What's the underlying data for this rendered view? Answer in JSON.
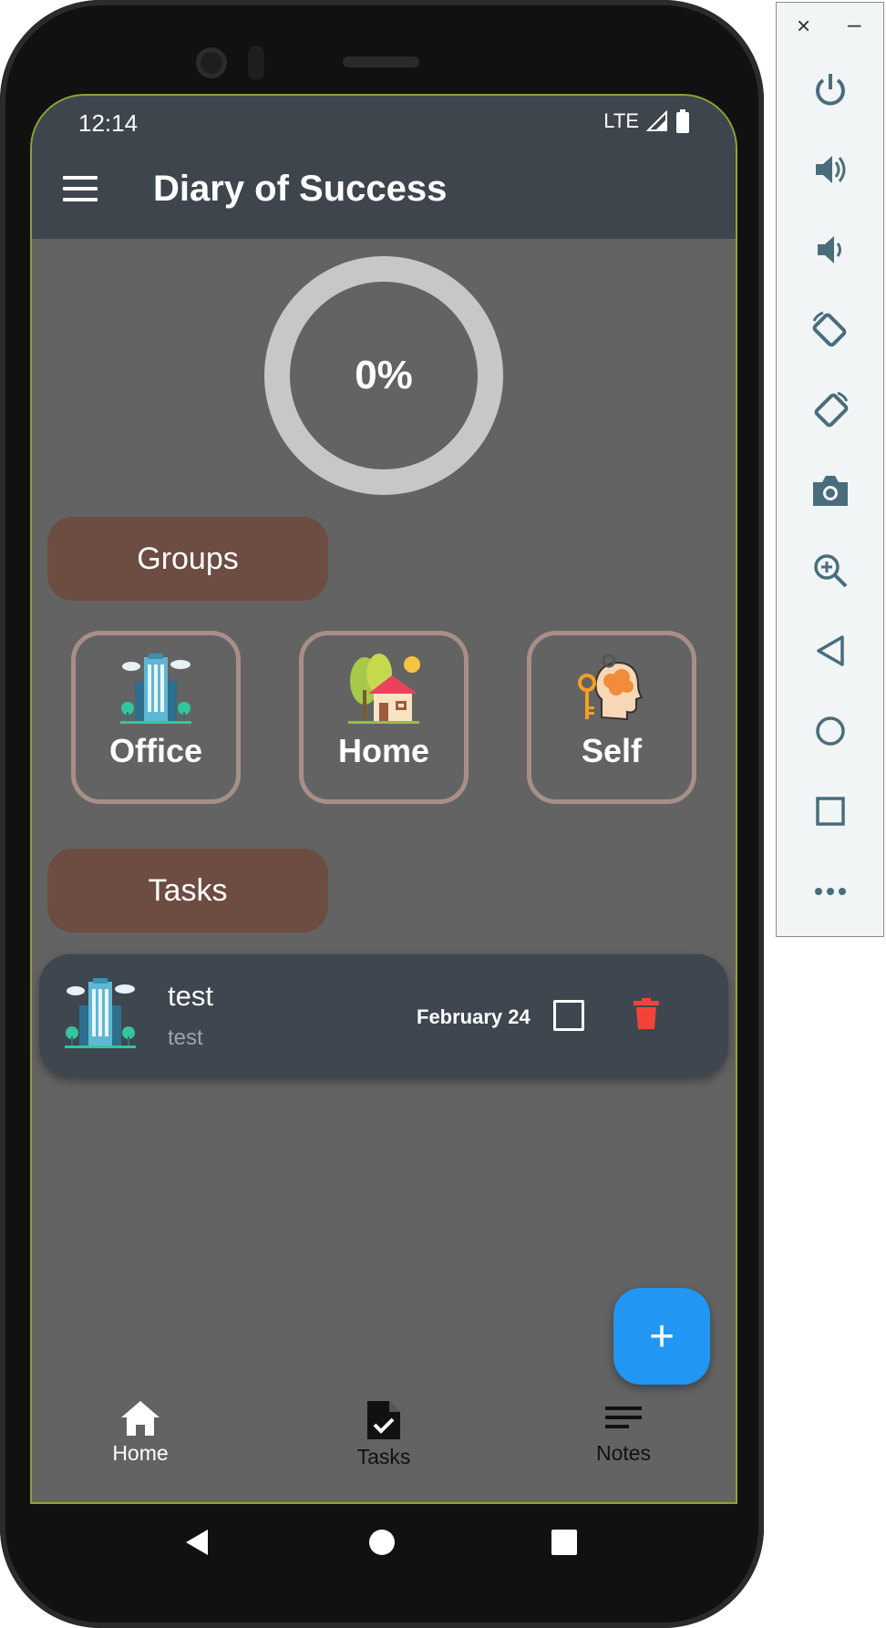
{
  "status_bar": {
    "time": "12:14",
    "network": "LTE"
  },
  "app_bar": {
    "title": "Diary of Success",
    "menu_icon": "hamburger-menu-icon"
  },
  "progress": {
    "label": "0%",
    "value": 0
  },
  "sections": {
    "groups": "Groups",
    "tasks": "Tasks"
  },
  "groups": [
    {
      "label": "Office",
      "icon": "office-building-icon"
    },
    {
      "label": "Home",
      "icon": "house-icon"
    },
    {
      "label": "Self",
      "icon": "brain-key-icon"
    }
  ],
  "tasks": [
    {
      "title": "test",
      "subtitle": "test",
      "date": "February 24",
      "done": false,
      "icon": "office-building-icon"
    }
  ],
  "fab": {
    "label": "+"
  },
  "bottom_nav": [
    {
      "label": "Home",
      "icon": "home-icon",
      "active": true
    },
    {
      "label": "Tasks",
      "icon": "task-document-icon",
      "active": false
    },
    {
      "label": "Notes",
      "icon": "notes-icon",
      "active": false
    }
  ],
  "colors": {
    "app_bar": "#3e454c",
    "background": "#636363",
    "section_pill": "#6d4c41",
    "group_border": "#a78f88",
    "task_card": "#3e4650",
    "fab": "#2196f3",
    "delete": "#f44336",
    "emulator_icon": "#4a6d7c"
  },
  "emulator_toolbar": {
    "close_label": "×",
    "minimize_label": "–",
    "buttons": [
      "power-icon",
      "volume-up-icon",
      "volume-down-icon",
      "rotate-left-icon",
      "rotate-right-icon",
      "camera-icon",
      "zoom-icon",
      "back-icon",
      "home-circle-icon",
      "overview-icon",
      "more-icon"
    ]
  }
}
